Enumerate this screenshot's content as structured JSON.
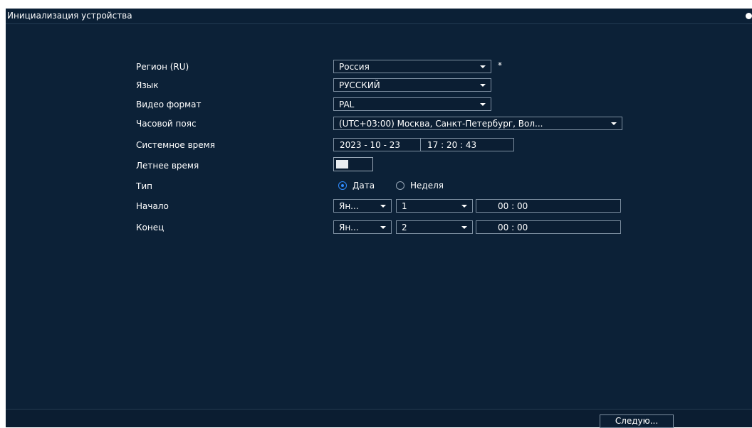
{
  "window": {
    "title": "Инициализация устройства"
  },
  "form": {
    "region": {
      "label": "Регион (RU)",
      "value": "Россия",
      "required_mark": "*"
    },
    "language": {
      "label": "Язык",
      "value": "РУССКИЙ"
    },
    "video_format": {
      "label": "Видео формат",
      "value": "PAL"
    },
    "timezone": {
      "label": "Часовой пояс",
      "value": "(UTC+03:00) Москва, Санкт-Петербург, Вол..."
    },
    "system_time": {
      "label": "Системное время",
      "date": "2023 - 10 - 23",
      "time": "17 : 20 : 43"
    },
    "dst": {
      "label": "Летнее время",
      "enabled": true
    },
    "type": {
      "label": "Тип",
      "options": [
        "Дата",
        "Неделя"
      ],
      "selected": "Дата"
    },
    "start": {
      "label": "Начало",
      "month": "Ян...",
      "day": "1",
      "time": "00 : 00"
    },
    "end": {
      "label": "Конец",
      "month": "Ян...",
      "day": "2",
      "time": "00 : 00"
    }
  },
  "footer": {
    "next_label": "Следую..."
  },
  "colors": {
    "background": "#0c2137",
    "field_border": "#7d8fa1",
    "accent": "#2f8cff"
  }
}
